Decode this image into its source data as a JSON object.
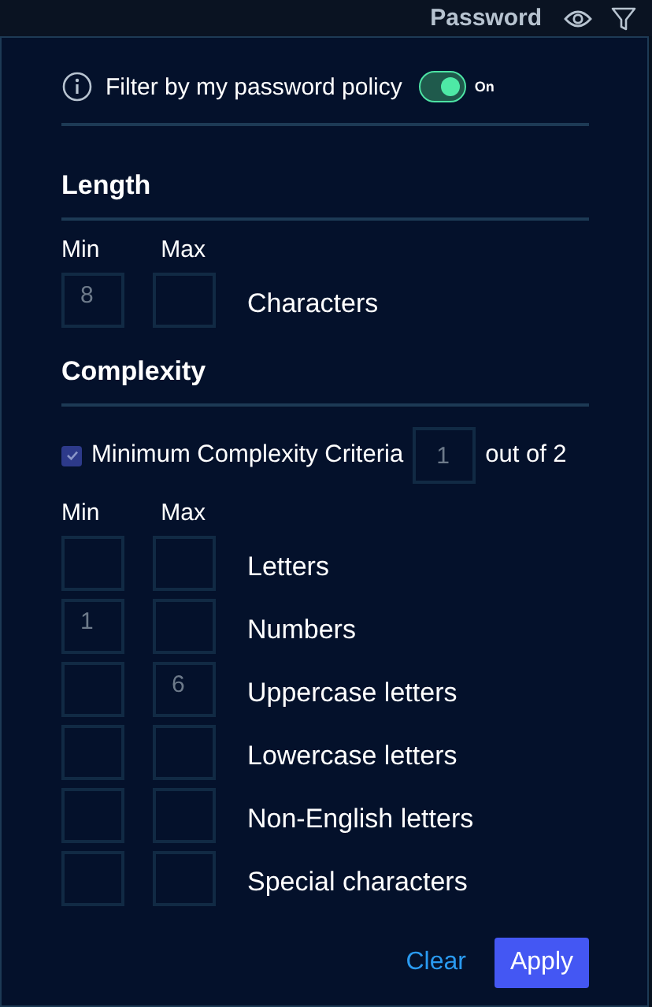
{
  "header": {
    "title": "Password"
  },
  "policy_filter": {
    "label": "Filter by my password policy",
    "on": true,
    "state_label": "On"
  },
  "length": {
    "title": "Length",
    "min_label": "Min",
    "max_label": "Max",
    "rows": [
      {
        "label": "Characters",
        "min": "8",
        "max": ""
      }
    ]
  },
  "complexity": {
    "title": "Complexity",
    "criteria": {
      "checked": true,
      "label": "Minimum Complexity Criteria",
      "value": "1",
      "suffix": "out of 2"
    },
    "min_label": "Min",
    "max_label": "Max",
    "rows": [
      {
        "label": "Letters",
        "min": "",
        "max": ""
      },
      {
        "label": "Numbers",
        "min": "1",
        "max": ""
      },
      {
        "label": "Uppercase letters",
        "min": "",
        "max": "6"
      },
      {
        "label": "Lowercase letters",
        "min": "",
        "max": ""
      },
      {
        "label": "Non-English letters",
        "min": "",
        "max": ""
      },
      {
        "label": "Special characters",
        "min": "",
        "max": ""
      }
    ]
  },
  "buttons": {
    "clear": "Clear",
    "apply": "Apply"
  }
}
